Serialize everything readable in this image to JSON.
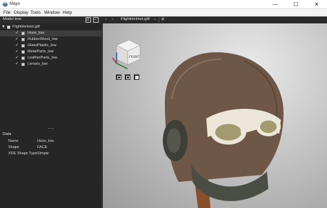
{
  "window": {
    "title": "Mayo",
    "minimize_glyph": "—",
    "maximize_glyph": "☐",
    "close_glyph": "✕"
  },
  "menu": [
    "File",
    "Display",
    "Tools",
    "Window",
    "Help"
  ],
  "model_tree": {
    "title": "Model tree",
    "root": "FlightHelmet.gltf",
    "items": [
      {
        "label": "Hose_low",
        "selected": true
      },
      {
        "label": "RubberWood_low",
        "selected": false
      },
      {
        "label": "GlassPlastic_low",
        "selected": false
      },
      {
        "label": "MetalParts_low",
        "selected": false
      },
      {
        "label": "LeatherParts_low",
        "selected": false
      },
      {
        "label": "Lenses_low",
        "selected": false
      }
    ]
  },
  "data_panel": {
    "title": "Data",
    "properties": [
      {
        "key": "Name",
        "value": "Hose_low"
      },
      {
        "key": "Shape",
        "value": "FACE"
      },
      {
        "key": "XDE Shape Type",
        "value": "Simple"
      }
    ]
  },
  "document": {
    "name": "FlightHelmet.gltf",
    "close_glyph": "✕",
    "back_glyph": "‹",
    "forward_glyph": "›",
    "chevron": "⌄"
  },
  "view_cube": {
    "face_label": "FRONT",
    "axes": {
      "x": "#c62828",
      "y": "#2e7d32",
      "z": "#1565c0"
    }
  },
  "colors": {
    "panel_bg": "#262626",
    "selected_row": "#3d3d3d",
    "viewport_bg": "#c6c6c6"
  }
}
